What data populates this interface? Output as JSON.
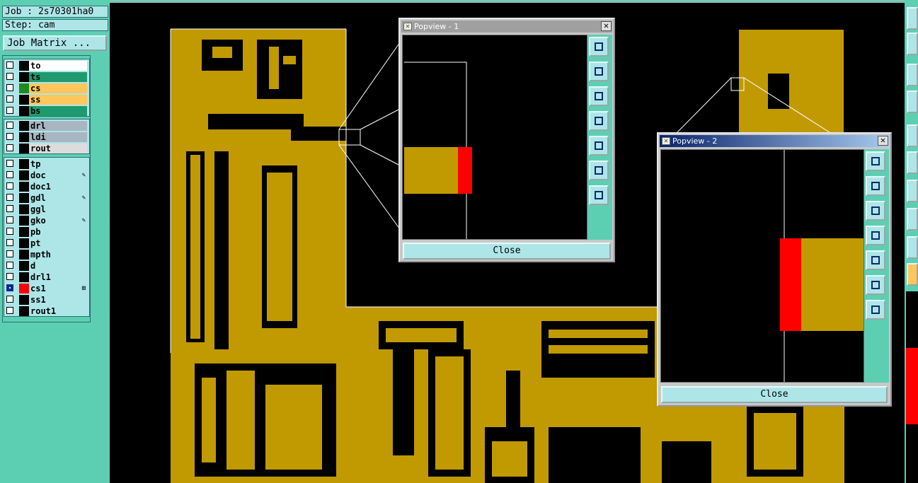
{
  "job": {
    "label": "Job : 2s70301ha0",
    "step": "Step: cam",
    "matrix_button": "Job Matrix ..."
  },
  "layers": {
    "group1": [
      {
        "name": "to",
        "swatch": "#000000",
        "fill": "#ffffff"
      },
      {
        "name": "ts",
        "swatch": "#000000",
        "fill": "#1f9a6e"
      },
      {
        "name": "cs",
        "swatch": "#1f8a1f",
        "fill": "#ffc65c"
      },
      {
        "name": "ss",
        "swatch": "#000000",
        "fill": "#ffc65c"
      },
      {
        "name": "bs",
        "swatch": "#000000",
        "fill": "#1f9a6e"
      }
    ],
    "group2": [
      {
        "name": "drl",
        "swatch": "#000000",
        "fill": "#a7b6c2"
      },
      {
        "name": "ldi",
        "swatch": "#000000",
        "fill": "#a7b6c2"
      },
      {
        "name": "rout",
        "swatch": "#000000",
        "fill": "#dcdcdc"
      }
    ],
    "group3": [
      {
        "name": "tp",
        "swatch": "#000000",
        "fill": "#aee6e8",
        "mark": ""
      },
      {
        "name": "doc",
        "swatch": "#000000",
        "fill": "#aee6e8",
        "mark": "✎"
      },
      {
        "name": "doc1",
        "swatch": "#000000",
        "fill": "#aee6e8",
        "mark": ""
      },
      {
        "name": "gdl",
        "swatch": "#000000",
        "fill": "#aee6e8",
        "mark": "✎"
      },
      {
        "name": "ggl",
        "swatch": "#000000",
        "fill": "#aee6e8",
        "mark": ""
      },
      {
        "name": "gko",
        "swatch": "#000000",
        "fill": "#aee6e8",
        "mark": "✎"
      },
      {
        "name": "pb",
        "swatch": "#000000",
        "fill": "#aee6e8",
        "mark": ""
      },
      {
        "name": "pt",
        "swatch": "#000000",
        "fill": "#aee6e8",
        "mark": ""
      },
      {
        "name": "mpth",
        "swatch": "#000000",
        "fill": "#aee6e8",
        "mark": ""
      },
      {
        "name": "d",
        "swatch": "#000000",
        "fill": "#aee6e8",
        "mark": ""
      },
      {
        "name": "drl1",
        "swatch": "#000000",
        "fill": "#aee6e8",
        "mark": ""
      },
      {
        "name": "cs1",
        "swatch": "#ff0000",
        "fill": "#aee6e8",
        "mark": "⊞",
        "active": true
      },
      {
        "name": "ss1",
        "swatch": "#000000",
        "fill": "#aee6e8",
        "mark": ""
      },
      {
        "name": "rout1",
        "swatch": "#000000",
        "fill": "#aee6e8",
        "mark": ""
      }
    ]
  },
  "popup1": {
    "title": "Popview - 1",
    "close_label": "Close"
  },
  "popup2": {
    "title": "Popview - 2",
    "close_label": "Close"
  },
  "colors": {
    "copper": "#c09a00",
    "background": "#000000",
    "highlight": "#ff0000",
    "panel": "#5ccfb3",
    "button": "#aee6e8"
  }
}
